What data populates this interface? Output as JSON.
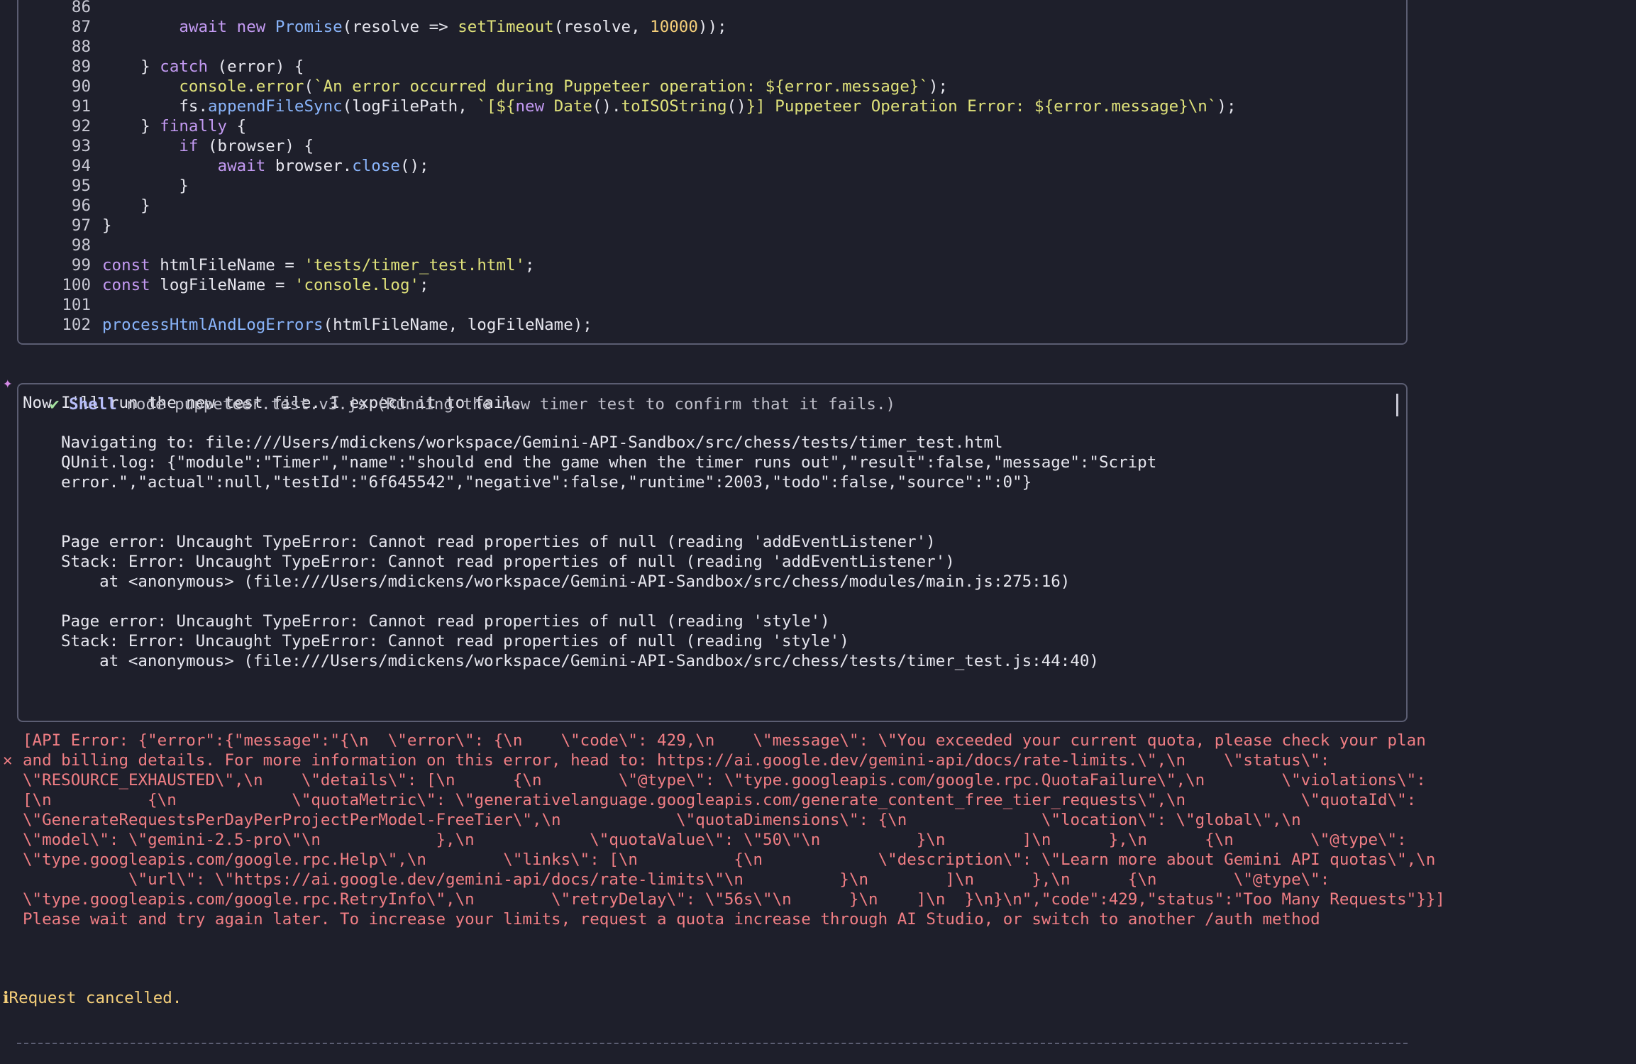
{
  "code_lines": [
    {
      "n": "86",
      "parts": []
    },
    {
      "n": "87",
      "parts": [
        [
          "",
          "        "
        ],
        [
          "kw",
          "await "
        ],
        [
          "kw",
          "new "
        ],
        [
          "fn",
          "Promise"
        ],
        [
          "op",
          "(resolve => "
        ],
        [
          "str",
          "setTimeout"
        ],
        [
          "op",
          "(resolve, "
        ],
        [
          "num",
          "10000"
        ],
        [
          "op",
          "));"
        ]
      ]
    },
    {
      "n": "88",
      "parts": []
    },
    {
      "n": "89",
      "parts": [
        [
          "",
          "    } "
        ],
        [
          "kw",
          "catch"
        ],
        [
          "op",
          " (error) {"
        ]
      ]
    },
    {
      "n": "90",
      "parts": [
        [
          "",
          "        "
        ],
        [
          "str",
          "console"
        ],
        [
          "op",
          "."
        ],
        [
          "str",
          "error"
        ],
        [
          "op",
          "("
        ],
        [
          "str",
          "`An error occurred during Puppeteer operation: ${error.message}`"
        ],
        [
          "op",
          ");"
        ]
      ]
    },
    {
      "n": "91",
      "parts": [
        [
          "",
          "        fs."
        ],
        [
          "fn",
          "appendFileSync"
        ],
        [
          "op",
          "(logFilePath, "
        ],
        [
          "str",
          "`[${"
        ],
        [
          "kw",
          "new "
        ],
        [
          "str",
          "Date"
        ],
        [
          "op",
          "()."
        ],
        [
          "str",
          "toISOString"
        ],
        [
          "op",
          "()"
        ],
        [
          "str",
          "}] Puppeteer Operation Error: ${error.message}\\n`"
        ],
        [
          "op",
          ");"
        ]
      ]
    },
    {
      "n": "92",
      "parts": [
        [
          "",
          "    } "
        ],
        [
          "kw",
          "finally"
        ],
        [
          "op",
          " {"
        ]
      ]
    },
    {
      "n": "93",
      "parts": [
        [
          "",
          "        "
        ],
        [
          "kw",
          "if"
        ],
        [
          "op",
          " (browser) {"
        ]
      ]
    },
    {
      "n": "94",
      "parts": [
        [
          "",
          "            "
        ],
        [
          "kw",
          "await"
        ],
        [
          "op",
          " browser."
        ],
        [
          "fn",
          "close"
        ],
        [
          "op",
          "();"
        ]
      ]
    },
    {
      "n": "95",
      "parts": [
        [
          "",
          "        }"
        ]
      ]
    },
    {
      "n": "96",
      "parts": [
        [
          "",
          "    }"
        ]
      ]
    },
    {
      "n": "97",
      "parts": [
        [
          "",
          "}"
        ]
      ]
    },
    {
      "n": "98",
      "parts": []
    },
    {
      "n": "99",
      "parts": [
        [
          "kw",
          "const"
        ],
        [
          "op",
          " htmlFileName = "
        ],
        [
          "str",
          "'tests/timer_test.html'"
        ],
        [
          "op",
          ";"
        ]
      ]
    },
    {
      "n": "100",
      "parts": [
        [
          "kw",
          "const"
        ],
        [
          "op",
          " logFileName = "
        ],
        [
          "str",
          "'console.log'"
        ],
        [
          "op",
          ";"
        ]
      ]
    },
    {
      "n": "101",
      "parts": []
    },
    {
      "n": "102",
      "parts": [
        [
          "fn",
          "processHtmlAndLogErrors"
        ],
        [
          "op",
          "(htmlFileName, logFileName);"
        ]
      ]
    }
  ],
  "assistant_message": "Now I'll run the new test file. I expect it to fail.",
  "sparkle_glyph": "✦",
  "shell": {
    "check_glyph": "✔",
    "title": "Shell",
    "command": "node puppeteer.test.v3.js (Running the new timer test to confirm that it fails.)",
    "output": [
      "Navigating to: file:///Users/mdickens/workspace/Gemini-API-Sandbox/src/chess/tests/timer_test.html",
      "QUnit.log: {\"module\":\"Timer\",\"name\":\"should end the game when the timer runs out\",\"result\":false,\"message\":\"Script",
      "error.\",\"actual\":null,\"testId\":\"6f645542\",\"negative\":false,\"runtime\":2003,\"todo\":false,\"source\":\":0\"}",
      "",
      "",
      "Page error: Uncaught TypeError: Cannot read properties of null (reading 'addEventListener')",
      "Stack: Error: Uncaught TypeError: Cannot read properties of null (reading 'addEventListener')",
      "    at <anonymous> (file:///Users/mdickens/workspace/Gemini-API-Sandbox/src/chess/modules/main.js:275:16)",
      "",
      "Page error: Uncaught TypeError: Cannot read properties of null (reading 'style')",
      "Stack: Error: Uncaught TypeError: Cannot read properties of null (reading 'style')",
      "    at <anonymous> (file:///Users/mdickens/workspace/Gemini-API-Sandbox/src/chess/tests/timer_test.js:44:40)"
    ]
  },
  "api_error": {
    "glyph": "✕",
    "lines": [
      "[API Error: {\"error\":{\"message\":\"{\\n  \\\"error\\\": {\\n    \\\"code\\\": 429,\\n    \\\"message\\\": \\\"You exceeded your current quota, please check your plan",
      "and billing details. For more information on this error, head to: https://ai.google.dev/gemini-api/docs/rate-limits.\\\",\\n    \\\"status\\\":",
      "\\\"RESOURCE_EXHAUSTED\\\",\\n    \\\"details\\\": [\\n      {\\n        \\\"@type\\\": \\\"type.googleapis.com/google.rpc.QuotaFailure\\\",\\n        \\\"violations\\\":",
      "[\\n          {\\n            \\\"quotaMetric\\\": \\\"generativelanguage.googleapis.com/generate_content_free_tier_requests\\\",\\n            \\\"quotaId\\\":",
      "\\\"GenerateRequestsPerDayPerProjectPerModel-FreeTier\\\",\\n            \\\"quotaDimensions\\\": {\\n              \\\"location\\\": \\\"global\\\",\\n",
      "\\\"model\\\": \\\"gemini-2.5-pro\\\"\\n            },\\n            \\\"quotaValue\\\": \\\"50\\\"\\n          }\\n        ]\\n      },\\n      {\\n        \\\"@type\\\":",
      "\\\"type.googleapis.com/google.rpc.Help\\\",\\n        \\\"links\\\": [\\n          {\\n            \\\"description\\\": \\\"Learn more about Gemini API quotas\\\",\\n",
      "           \\\"url\\\": \\\"https://ai.google.dev/gemini-api/docs/rate-limits\\\"\\n          }\\n        ]\\n      },\\n      {\\n        \\\"@type\\\":",
      "\\\"type.googleapis.com/google.rpc.RetryInfo\\\",\\n        \\\"retryDelay\\\": \\\"56s\\\"\\n      }\\n    ]\\n  }\\n}\\n\",\"code\":429,\"status\":\"Too Many Requests\"}}]",
      "Please wait and try again later. To increase your limits, request a quota increase through AI Studio, or switch to another /auth method"
    ]
  },
  "cancel_message": "ℹRequest cancelled."
}
